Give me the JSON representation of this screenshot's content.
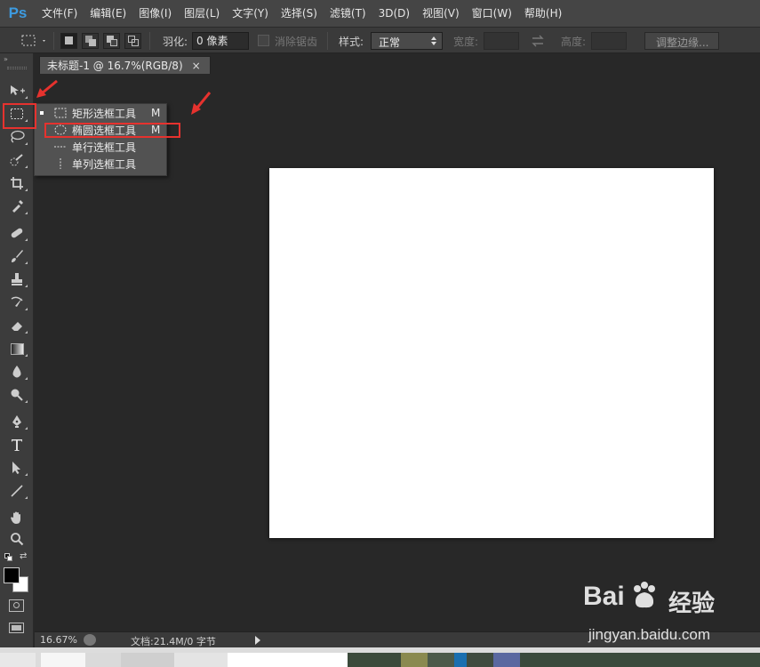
{
  "app": {
    "logo": "Ps"
  },
  "menubar": {
    "items": [
      "文件(F)",
      "编辑(E)",
      "图像(I)",
      "图层(L)",
      "文字(Y)",
      "选择(S)",
      "滤镜(T)",
      "3D(D)",
      "视图(V)",
      "窗口(W)",
      "帮助(H)"
    ]
  },
  "options_bar": {
    "feather_label": "羽化:",
    "feather_value": "0 像素",
    "antialias_label": "消除锯齿",
    "style_label": "样式:",
    "style_value": "正常",
    "width_label": "宽度:",
    "height_label": "高度:",
    "refine_edge_label": "调整边缘..."
  },
  "document": {
    "tab_title": "未标题-1 @ 16.7%(RGB/8)",
    "close_glyph": "×"
  },
  "flyout": {
    "items": [
      {
        "label": "矩形选框工具",
        "shortcut": "M",
        "icon": "rect-marquee-icon",
        "selected": true
      },
      {
        "label": "椭圆选框工具",
        "shortcut": "M",
        "icon": "ellipse-marquee-icon",
        "selected": false
      },
      {
        "label": "单行选框工具",
        "shortcut": "",
        "icon": "single-row-marquee-icon",
        "selected": false
      },
      {
        "label": "单列选框工具",
        "shortcut": "",
        "icon": "single-column-marquee-icon",
        "selected": false
      }
    ]
  },
  "statusbar": {
    "zoom": "16.67%",
    "doc_info": "文档:21.4M/0 字节"
  },
  "watermark": {
    "brand": "Bai",
    "brand_cn": "经验",
    "url": "jingyan.baidu.com"
  },
  "colors": {
    "annotation": "#e6322e",
    "ps_blue": "#3d9be0"
  }
}
